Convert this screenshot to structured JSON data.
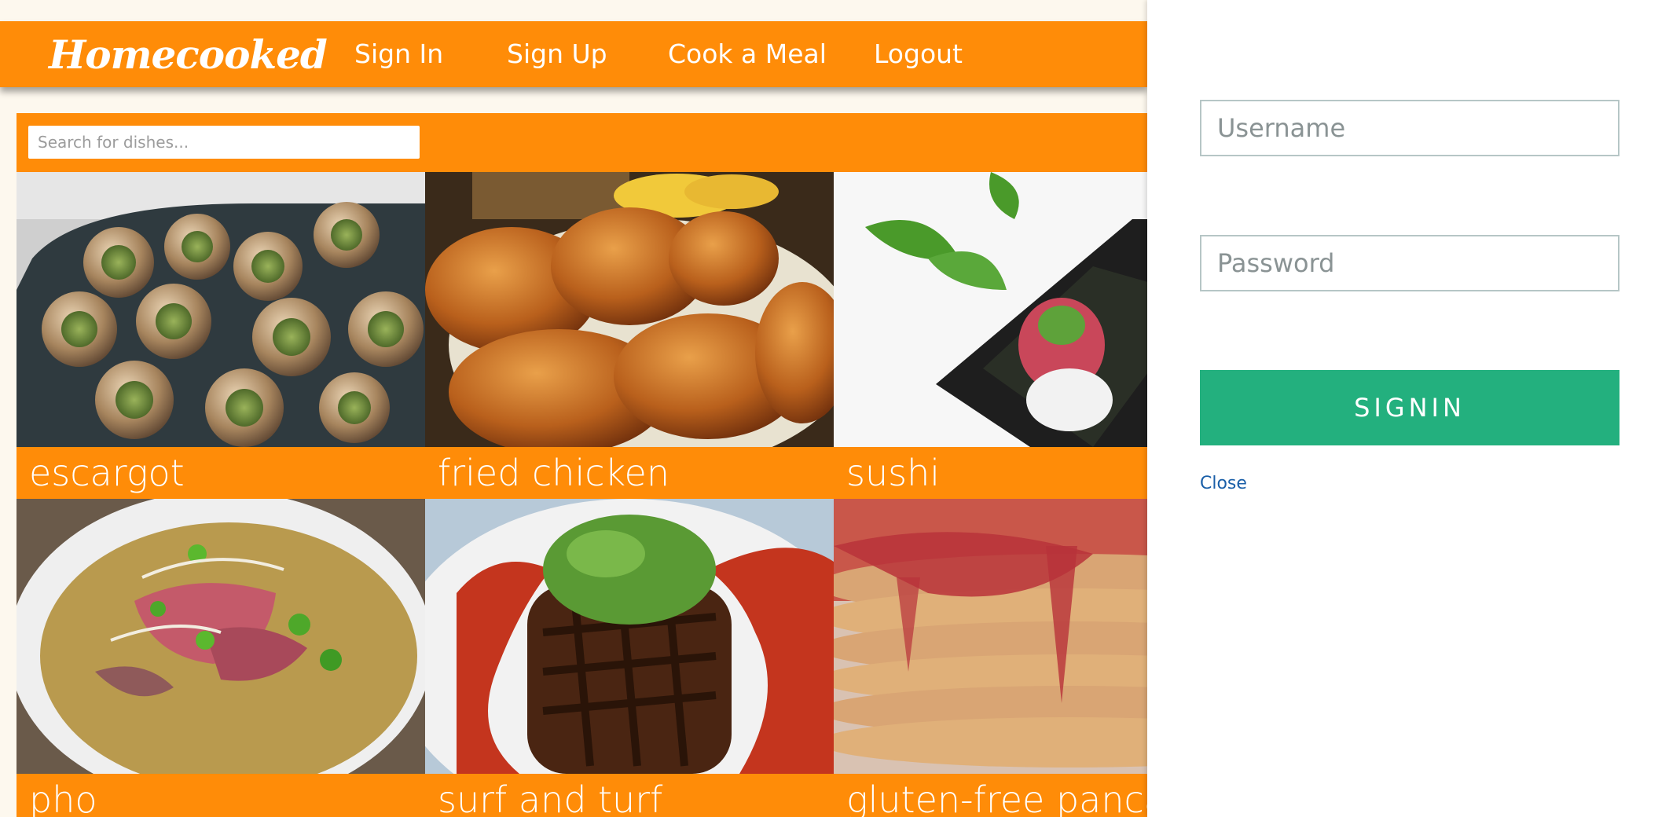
{
  "navbar": {
    "brand": "Homecooked",
    "links": [
      "Sign In",
      "Sign Up",
      "Cook a Meal",
      "Logout"
    ],
    "color": "#ff8c08"
  },
  "search": {
    "placeholder": "Search for dishes..."
  },
  "dishes": [
    {
      "name": "escargot",
      "image": "escargot-photo"
    },
    {
      "name": "fried chicken",
      "image": "fried-chicken-photo"
    },
    {
      "name": "sushi",
      "image": "sushi-photo"
    },
    {
      "name": "pho",
      "image": "pho-photo"
    },
    {
      "name": "surf and turf",
      "image": "surf-and-turf-photo"
    },
    {
      "name": "gluten-free pancakes",
      "image": "pancakes-photo"
    }
  ],
  "signin_panel": {
    "username_placeholder": "Username",
    "password_placeholder": "Password",
    "submit_label": "SIGNIN",
    "close_label": "Close",
    "button_color": "#23b07e"
  }
}
